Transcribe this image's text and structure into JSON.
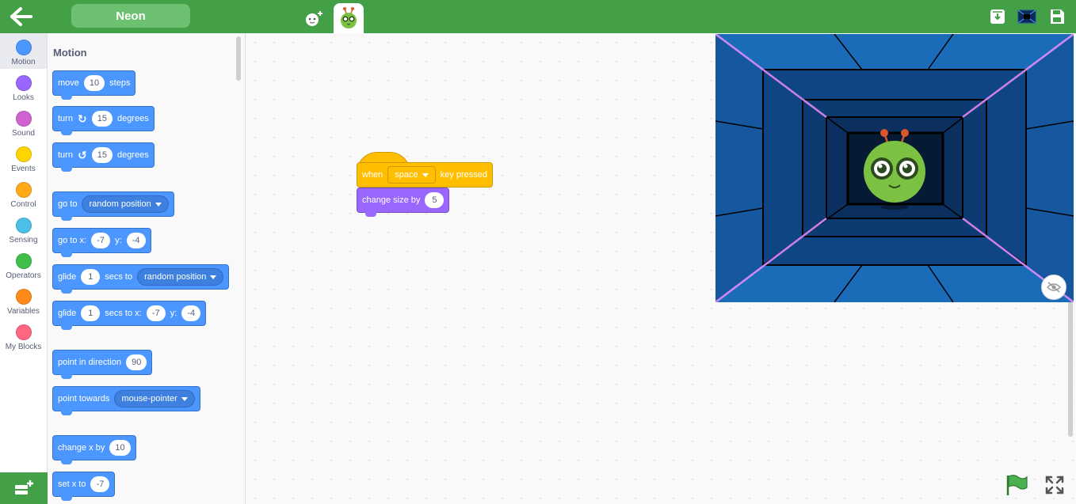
{
  "topbar": {
    "project_name": "Neon",
    "icons": [
      "back-arrow-icon",
      "add-sprite-icon",
      "sprite-thumbnail-icon",
      "download-icon",
      "stage-size-icon",
      "save-icon"
    ]
  },
  "categories": [
    {
      "label": "Motion",
      "color": "#4c97ff"
    },
    {
      "label": "Looks",
      "color": "#9966ff"
    },
    {
      "label": "Sound",
      "color": "#cf63cf"
    },
    {
      "label": "Events",
      "color": "#ffd500"
    },
    {
      "label": "Control",
      "color": "#ffab19"
    },
    {
      "label": "Sensing",
      "color": "#4cbfe6"
    },
    {
      "label": "Operators",
      "color": "#40bf4a"
    },
    {
      "label": "Variables",
      "color": "#ff8c1a"
    },
    {
      "label": "My Blocks",
      "color": "#ff6680"
    }
  ],
  "palette": {
    "title": "Motion",
    "blocks": {
      "move": {
        "pre": "move",
        "value": "10",
        "post": "steps"
      },
      "turn_right": {
        "pre": "turn",
        "value": "15",
        "post": "degrees"
      },
      "turn_left": {
        "pre": "turn",
        "value": "15",
        "post": "degrees"
      },
      "goto": {
        "pre": "go to",
        "option": "random position"
      },
      "goto_xy": {
        "pre": "go to x:",
        "x": "-7",
        "ylabel": "y:",
        "y": "-4"
      },
      "glide": {
        "pre": "glide",
        "value": "1",
        "mid": "secs to",
        "option": "random position"
      },
      "glide_xy": {
        "pre": "glide",
        "value": "1",
        "mid": "secs to x:",
        "x": "-7",
        "ylabel": "y:",
        "y": "-4"
      },
      "point_dir": {
        "pre": "point in direction",
        "value": "90"
      },
      "point_towards": {
        "pre": "point towards",
        "option": "mouse-pointer"
      },
      "change_x": {
        "pre": "change x by",
        "value": "10"
      },
      "set_x": {
        "pre": "set x to",
        "value": "-7"
      }
    }
  },
  "script": {
    "hat": {
      "pre": "when",
      "key": "space",
      "post": "key pressed"
    },
    "change_size": {
      "pre": "change size by",
      "value": "5"
    }
  }
}
